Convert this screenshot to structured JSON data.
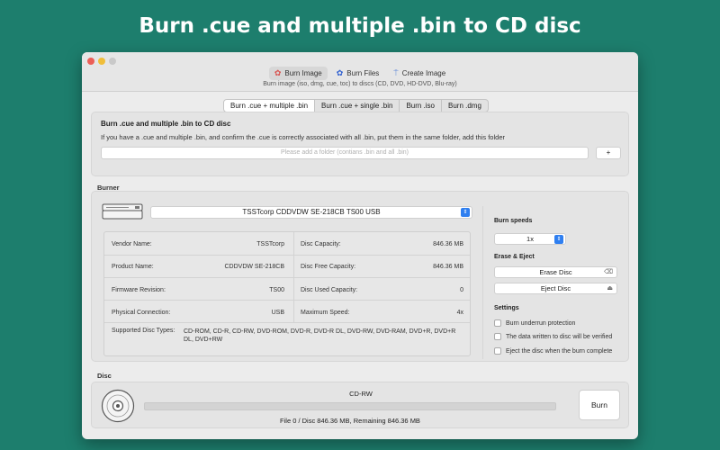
{
  "hero": {
    "title": "Burn .cue and multiple .bin to CD disc"
  },
  "toolbar": {
    "tabs": [
      {
        "label": "Burn Image",
        "icon": "burn-image-icon"
      },
      {
        "label": "Burn Files",
        "icon": "burn-files-icon"
      },
      {
        "label": "Create Image",
        "icon": "create-image-icon"
      }
    ],
    "subtitle": "Burn image (iso, dmg, cue, toc) to discs (CD, DVD, HD-DVD, Blu-ray)"
  },
  "segments": [
    {
      "label": "Burn .cue + multiple .bin"
    },
    {
      "label": "Burn .cue + single .bin"
    },
    {
      "label": "Burn .iso"
    },
    {
      "label": "Burn .dmg"
    }
  ],
  "cue_panel": {
    "title": "Burn .cue and multiple .bin to CD disc",
    "description": "If you have a .cue and multiple .bin, and confirm the .cue is correctly associated with all .bin, put them in the same folder, add this folder",
    "folder_placeholder": "Please add a folder (contians .bin and all .bin)",
    "add_label": "+"
  },
  "burner": {
    "section_label": "Burner",
    "drive": "TSSTcorp CDDVDW SE-218CB TS00 USB",
    "info_left": [
      {
        "label": "Vendor Name:",
        "value": "TSSTcorp"
      },
      {
        "label": "Product Name:",
        "value": "CDDVDW SE-218CB"
      },
      {
        "label": "Firmware Revision:",
        "value": "TS00"
      },
      {
        "label": "Physical Connection:",
        "value": "USB"
      }
    ],
    "info_right": [
      {
        "label": "Disc Capacity:",
        "value": "846.36 MB"
      },
      {
        "label": "Disc Free Capacity:",
        "value": "846.36 MB"
      },
      {
        "label": "Disc Used Capacity:",
        "value": "0"
      },
      {
        "label": "Maximum Speed:",
        "value": "4x"
      }
    ],
    "supported_label": "Supported Disc Types:",
    "supported_value": "CD-ROM, CD-R, CD-RW, DVD-ROM, DVD-R, DVD-R DL, DVD-RW, DVD-RAM, DVD+R, DVD+R DL, DVD+RW",
    "speeds_label": "Burn speeds",
    "speed_value": "1x",
    "erase_eject_label": "Erase & Eject",
    "erase_label": "Erase Disc",
    "eject_label": "Eject Disc",
    "settings_label": "Settings",
    "settings": [
      {
        "label": "Burn underrun protection"
      },
      {
        "label": "The data written to disc will be verified"
      },
      {
        "label": "Eject the disc when the burn complete"
      }
    ]
  },
  "disc": {
    "section_label": "Disc",
    "type": "CD-RW",
    "progress": 0,
    "status": "File 0 / Disc 846.36 MB, Remaining 846.36 MB",
    "burn_label": "Burn"
  },
  "colors": {
    "background": "#1d7e6d",
    "accent": "#2f7ff0"
  }
}
